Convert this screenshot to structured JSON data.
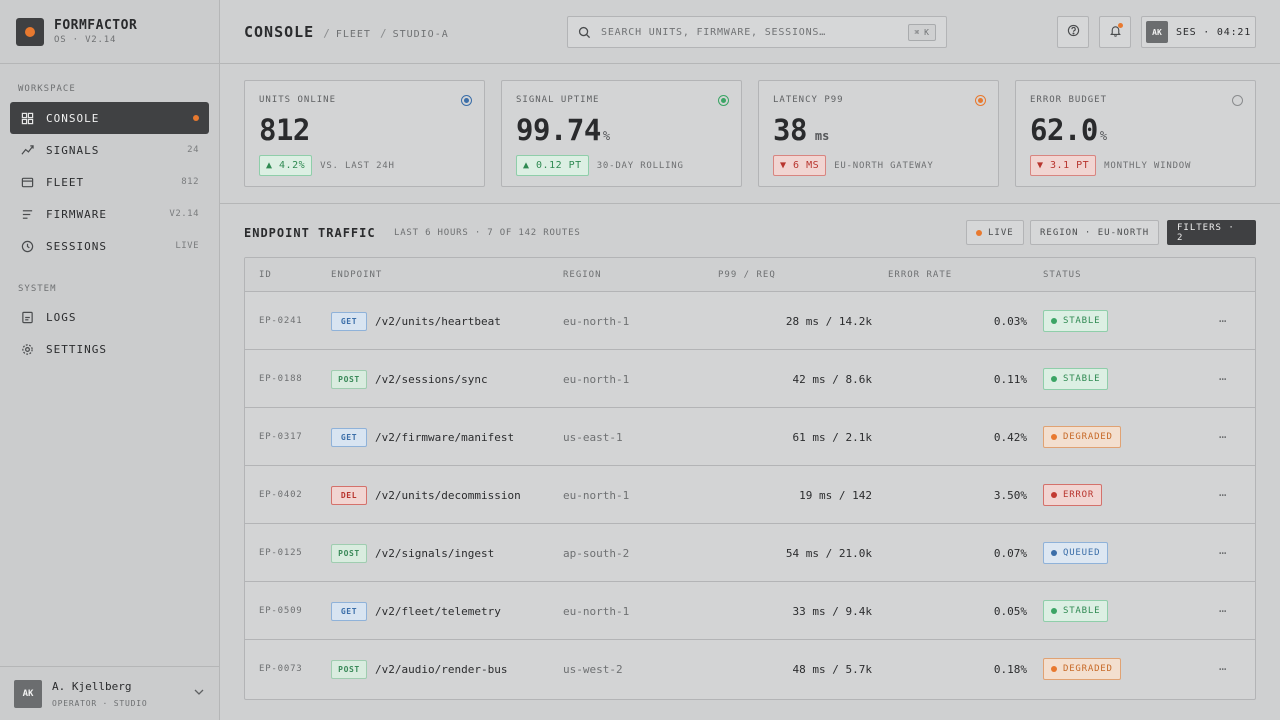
{
  "brand": {
    "name": "FORMFACTOR",
    "version": "OS · V2.14"
  },
  "sidebar": {
    "workspace_title": "WORKSPACE",
    "system_title": "SYSTEM",
    "items": [
      {
        "label": "CONSOLE",
        "badge": "",
        "icon": "grid-icon",
        "active": true
      },
      {
        "label": "SIGNALS",
        "badge": "24",
        "icon": "trend-icon"
      },
      {
        "label": "FLEET",
        "badge": "812",
        "icon": "box-icon"
      },
      {
        "label": "FIRMWARE",
        "badge": "V2.14",
        "icon": "list-icon"
      },
      {
        "label": "SESSIONS",
        "badge": "LIVE",
        "icon": "clock-icon"
      },
      {
        "label": "LOGS",
        "badge": "",
        "icon": "doc-icon"
      },
      {
        "label": "SETTINGS",
        "badge": "",
        "icon": "gear-icon"
      }
    ],
    "user": {
      "initials": "AK",
      "name": "A. Kjellberg",
      "role": "OPERATOR · STUDIO"
    }
  },
  "header": {
    "title": "CONSOLE",
    "crumbs": [
      "FLEET",
      "STUDIO-A"
    ],
    "search_placeholder": "SEARCH UNITS, FIRMWARE, SESSIONS…",
    "search_shortcut": "⌘ K",
    "session_initials": "AK",
    "session_label": "SES · 04:21"
  },
  "kpis": [
    {
      "label": "UNITS ONLINE",
      "value": "812",
      "unit": "",
      "delta": "▲ 4.2%",
      "dir": "up",
      "note": "VS. LAST 24H",
      "ring": "#3b6ea8"
    },
    {
      "label": "SIGNAL UPTIME",
      "value": "99.74",
      "unit": "%",
      "delta": "▲ 0.12 PT",
      "dir": "up",
      "note": "30-DAY ROLLING",
      "ring": "#3ba565"
    },
    {
      "label": "LATENCY P99",
      "value": "38",
      "unit": "ms",
      "delta": "▼ 6 MS",
      "dir": "down",
      "note": "EU-NORTH GATEWAY",
      "ring": "#e8792f"
    },
    {
      "label": "ERROR BUDGET",
      "value": "62.0",
      "unit": "%",
      "delta": "▼ 3.1 PT",
      "dir": "down",
      "note": "MONTHLY WINDOW",
      "ring": "#8a8c8e"
    }
  ],
  "traffic": {
    "title": "ENDPOINT TRAFFIC",
    "subtitle": "LAST 6 HOURS · 7 OF 142 ROUTES",
    "live_label": "LIVE",
    "region_label": "REGION · EU-NORTH",
    "filters_label": "FILTERS · 2",
    "columns": [
      "ID",
      "ENDPOINT",
      "REGION",
      "P99 / REQ",
      "ERROR RATE",
      "STATUS"
    ],
    "rows": [
      {
        "id": "EP-0241",
        "method": "GET",
        "path": "/v2/units/heartbeat",
        "region": "eu-north-1",
        "p99": "28 ms / 14.2k",
        "err": "0.03%",
        "status": "STABLE"
      },
      {
        "id": "EP-0188",
        "method": "POST",
        "path": "/v2/sessions/sync",
        "region": "eu-north-1",
        "p99": "42 ms / 8.6k",
        "err": "0.11%",
        "status": "STABLE"
      },
      {
        "id": "EP-0317",
        "method": "GET",
        "path": "/v2/firmware/manifest",
        "region": "us-east-1",
        "p99": "61 ms / 2.1k",
        "err": "0.42%",
        "status": "DEGRADED"
      },
      {
        "id": "EP-0402",
        "method": "DEL",
        "path": "/v2/units/decommission",
        "region": "eu-north-1",
        "p99": "19 ms / 142",
        "err": "3.50%",
        "status": "ERROR"
      },
      {
        "id": "EP-0125",
        "method": "POST",
        "path": "/v2/signals/ingest",
        "region": "ap-south-2",
        "p99": "54 ms / 21.0k",
        "err": "0.07%",
        "status": "QUEUED"
      },
      {
        "id": "EP-0509",
        "method": "GET",
        "path": "/v2/fleet/telemetry",
        "region": "eu-north-1",
        "p99": "33 ms / 9.4k",
        "err": "0.05%",
        "status": "STABLE"
      },
      {
        "id": "EP-0073",
        "method": "POST",
        "path": "/v2/audio/render-bus",
        "region": "us-west-2",
        "p99": "48 ms / 5.7k",
        "err": "0.18%",
        "status": "DEGRADED"
      }
    ],
    "more_glyph": "⋯"
  }
}
